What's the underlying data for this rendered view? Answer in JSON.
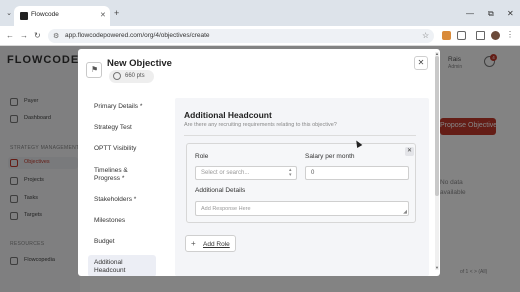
{
  "browser": {
    "tab_title": "Flowcode",
    "tab_close": "✕",
    "new_tab": "+",
    "url": "app.flowcodepowered.com/org/4/objectives/create",
    "controls": {
      "minimize": "—",
      "maximize": "⧉",
      "close": "✕"
    }
  },
  "background_app": {
    "logo": "FLOWCODE",
    "user_name": "Rais",
    "user_sub": "Admin",
    "notification_count": "4",
    "sidebar": {
      "items_top": [
        {
          "label": "Payer"
        },
        {
          "label": "Dashboard"
        }
      ],
      "section_strategy": "STRATEGY MANAGEMENT",
      "items_strategy": [
        {
          "label": "Objectives",
          "active": true
        },
        {
          "label": "Projects"
        },
        {
          "label": "Tasks"
        },
        {
          "label": "Targets"
        }
      ],
      "section_resources": "RESOURCES",
      "items_resources": [
        {
          "label": "Flowcopedia"
        }
      ]
    },
    "cta_label": "Propose Objective",
    "empty_line1": "No data",
    "empty_line2": "available",
    "pagination": "of 1 < >  (All)"
  },
  "modal": {
    "title": "New Objective",
    "points": "660 pts",
    "close_icon": "✕",
    "steps": [
      {
        "label": "Primary Details *"
      },
      {
        "label": "Strategy Test"
      },
      {
        "label": "OPTT Visibility"
      },
      {
        "label": "Timelines &\nProgress *"
      },
      {
        "label": "Stakeholders *"
      },
      {
        "label": "Milestones"
      },
      {
        "label": "Budget"
      },
      {
        "label": "Additional\nHeadcount",
        "active": true
      }
    ],
    "section": {
      "title": "Additional Headcount",
      "subtitle": "Are there any recruiting requirements relating to this objective?",
      "role_label": "Role",
      "role_placeholder": "Select or search...",
      "salary_label": "Salary per month",
      "salary_value": "0",
      "details_label": "Additional Details",
      "details_placeholder": "Add Response Here",
      "add_role": "Add Role"
    }
  },
  "colors": {
    "accent": "#c0392b",
    "overlay": "rgba(0,0,0,0.48)"
  }
}
